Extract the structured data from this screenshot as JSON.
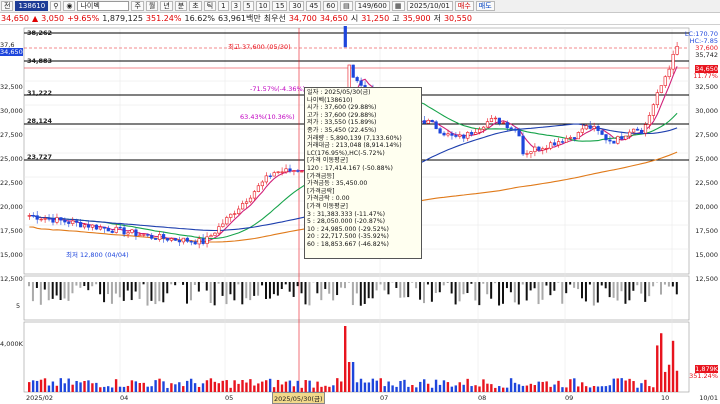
{
  "toolbar": {
    "code_label": "전",
    "stock_code": "138610",
    "stock_name": "나이벡",
    "period_tabs": [
      "주",
      "월",
      "년",
      "분",
      "초",
      "틱"
    ],
    "numbers": [
      "1",
      "3",
      "5",
      "10",
      "15",
      "30",
      "45",
      "60"
    ],
    "counter": "149/600",
    "date": "2025/10/01",
    "buy": "매수",
    "sell": "매도"
  },
  "quote": {
    "price": "34,650",
    "change": "3,050",
    "change_pct": "+9.65%",
    "volume": "1,879,125",
    "vol_ratio": "351.24%",
    "turnover": "16.62%",
    "amount": "63,961백만",
    "rank": "최우선",
    "bid": "34,700",
    "ask": "34,650",
    "open_label": "시",
    "open": "31,250",
    "high_label": "고",
    "high": "35,900",
    "low_label": "저",
    "low": "30,550"
  },
  "price_axis": [
    "38,262",
    "37,6",
    "34,883",
    "31,222",
    "28,124",
    "23,727",
    "32,500",
    "30,000",
    "27,500",
    "25,000",
    "22,500",
    "20,000",
    "17,500",
    "15,000",
    "12,500"
  ],
  "right_axis": {
    "lc": "LC:170.70",
    "hc": "HC:-7.85",
    "r1": "37,600",
    "r2": "35,742",
    "r3": "34,650",
    "r4": "11.77%",
    "r5": "32,500",
    "r6": "30,000",
    "r7": "27,500",
    "r8": "25,000",
    "r9": "22,500",
    "r10": "20,000",
    "r11": "17,500",
    "r12": "15,000",
    "r13": "12,500",
    "v1": "1,879K",
    "v2": "351.24%",
    "vmax": "4,000K",
    "vmid": "2,000K"
  },
  "annotations": {
    "high": "최고 37,600 (05/30)",
    "low": "최저 12,800 (04/04)",
    "pct1": "-71.57%(-4.36%)",
    "pct2": "63.43%(10.36%)"
  },
  "osc_label": "5",
  "date_axis": [
    "2025/02",
    "04",
    "05",
    "2025/05/30(금)",
    "07",
    "08",
    "09",
    "10",
    "10/01"
  ],
  "tooltip": [
    "일자      : 2025/05/30(금)",
    "나이벡(138610)",
    "  시가      : 37,600 (29.88%)",
    "  고가      : 37,600 (29.88%)",
    "  저가      : 33,550 (15.89%)",
    "  종가      : 35,450 (22.45%)",
    "  거래량    : 5,890,139 (7,133.60%)",
    "  거래대금  : 213,048 (8,914.14%)",
    "LC(176.95%),HC(-5.72%)",
    "[가격 이동평균]",
    "  120      : 17,414.167 (-50.88%)",
    "[가격금등]",
    "  가격금등 : 35,450.00",
    "[가격금락]",
    "  가격금락 : 0.00",
    "[가격 이동평균]",
    "  3        : 31,383.333 (-11.47%)",
    "  5        : 28,050.000 (-20.87%)",
    "  10       : 24,985.000 (-29.52%)",
    "  20       : 22,717.500 (-35.92%)",
    "  60       : 18,853.667 (-46.82%)"
  ],
  "colors": {
    "up": "#e8141e",
    "down": "#1e46dc",
    "ma5": "#d1217a",
    "ma20": "#16a34a",
    "ma60": "#1e3fae",
    "ma120": "#e07a1a",
    "vol_up": "#e8141e",
    "vol_down": "#1e46dc"
  }
}
